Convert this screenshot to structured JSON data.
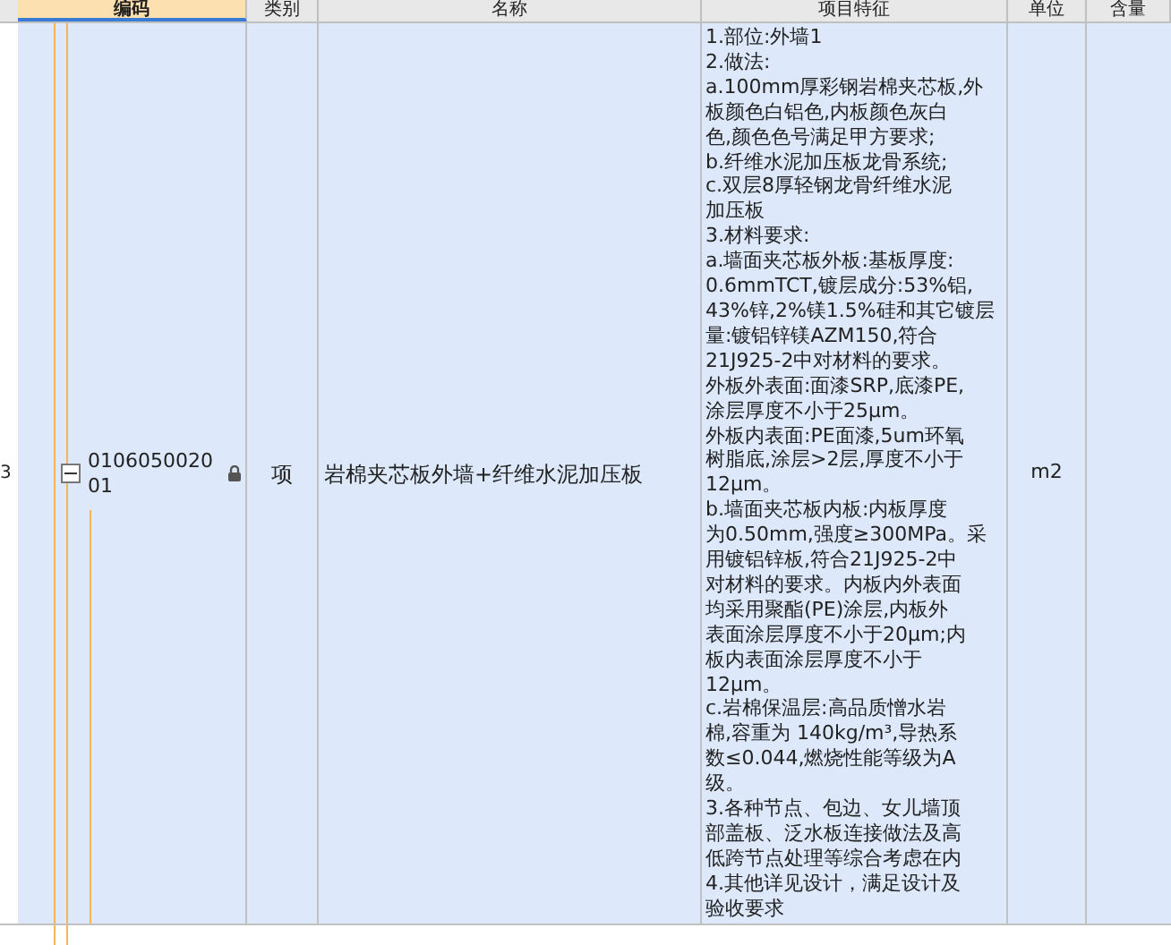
{
  "columns": [
    {
      "label": "编码",
      "selected": true
    },
    {
      "label": "类别",
      "selected": false
    },
    {
      "label": "名称",
      "selected": false
    },
    {
      "label": "项目特征",
      "selected": false
    },
    {
      "label": "单位",
      "selected": false
    },
    {
      "label": "含量",
      "selected": false
    }
  ],
  "row": {
    "number": "3",
    "expanded": true,
    "locked": true,
    "code": "010605002001",
    "category": "项",
    "name": "岩棉夹芯板外墙+纤维水泥加压板",
    "unit": "m2",
    "features": [
      "1.部位:外墙1",
      "2.做法:",
      "a.100mm厚彩钢岩棉夹芯板,外",
      "板颜色白铝色,内板颜色灰白",
      "色,颜色色号满足甲方要求;",
      "b.纤维水泥加压板龙骨系统;",
      "c.双层8厚轻钢龙骨纤维水泥",
      "加压板",
      "3.材料要求:",
      "a.墙面夹芯板外板:基板厚度:",
      "0.6mmTCT,镀层成分:53%铝,",
      "43%锌,2%镁1.5%硅和其它镀层",
      "量:镀铝锌镁AZM150,符合",
      "21J925-2中对材料的要求。",
      "外板外表面:面漆SRP,底漆PE,",
      "涂层厚度不小于25μm。",
      "外板内表面:PE面漆,5um环氧",
      "树脂底,涂层>2层,厚度不小于",
      "12μm。",
      "b.墙面夹芯板内板:内板厚度",
      "为0.50mm,强度≥300MPa。采",
      "用镀铝锌板,符合21J925-2中",
      "对材料的要求。内板内外表面",
      "均采用聚酯(PE)涂层,内板外",
      "表面涂层厚度不小于20μm;内",
      "板内表面涂层厚度不小于",
      "12μm。",
      "c.岩棉保温层:高品质憎水岩",
      "棉,容重为 140kg/m³,导热系",
      "数≤0.044,燃烧性能等级为A",
      "级。",
      "3.各种节点、包边、女儿墙顶",
      "部盖板、泛水板连接做法及高",
      "低跨节点处理等综合考虑在内",
      "4.其他详见设计，满足设计及",
      "验收要求"
    ]
  }
}
